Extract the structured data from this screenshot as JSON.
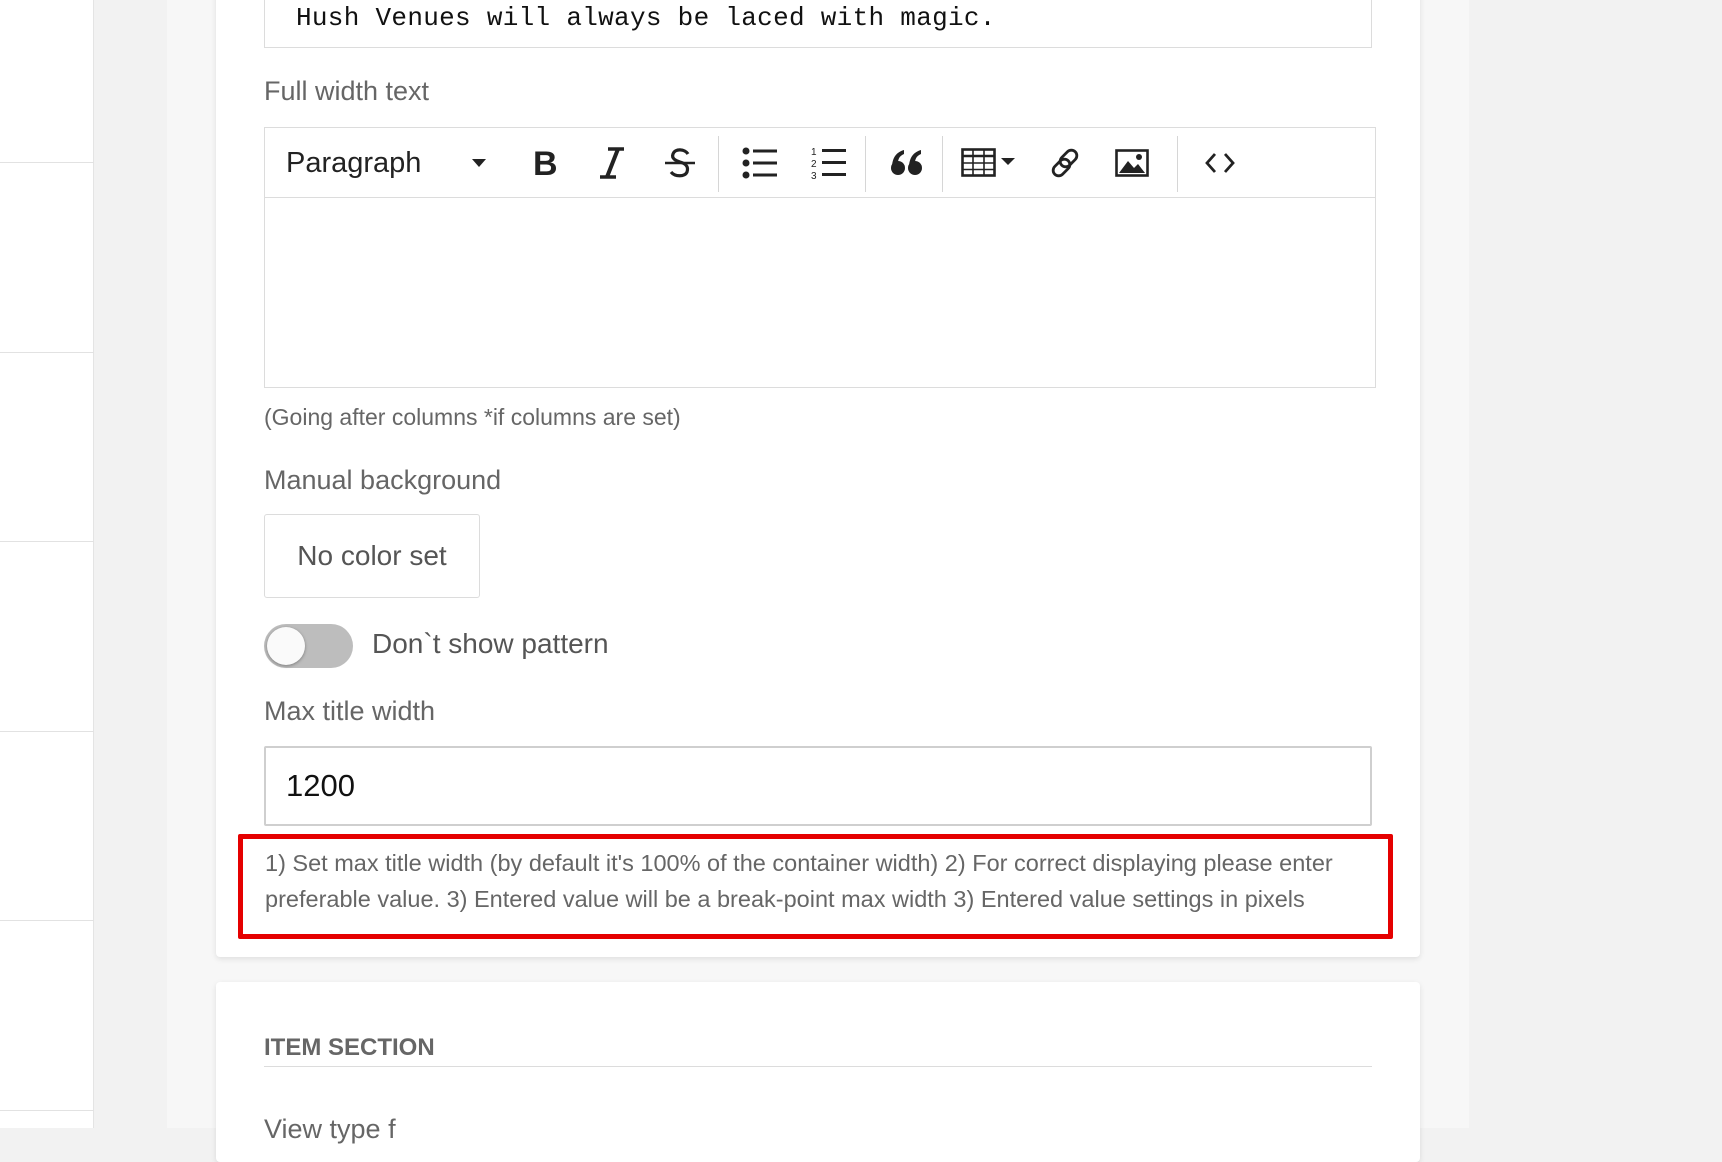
{
  "text_line": {
    "value": "Hush Venues will always be laced with magic."
  },
  "full_width_text": {
    "label": "Full width text",
    "help": "(Going after columns *if columns are set)",
    "toolbar": {
      "paragraph": "Paragraph",
      "buttons": [
        "bold",
        "italic",
        "strikethrough",
        "bulleted-list",
        "numbered-list",
        "block-quote",
        "insert-table",
        "link",
        "insert-image",
        "source-code"
      ]
    },
    "content": ""
  },
  "manual_background": {
    "label": "Manual background",
    "button": "No color set"
  },
  "pattern_toggle": {
    "label": "Don`t show pattern",
    "on": false
  },
  "max_title_width": {
    "label": "Max title width",
    "value": "1200",
    "note": "1) Set max title width (by default it's 100% of the container width) 2) For correct displaying please enter preferable value. 3) Entered value will be a break-point max width 3) Entered value settings in pixels"
  },
  "item_section": {
    "title": "ITEM SECTION",
    "next_label_partial": "View type f"
  },
  "colors": {
    "highlight": "#e50000",
    "toggle_off": "#bdbdbd"
  }
}
